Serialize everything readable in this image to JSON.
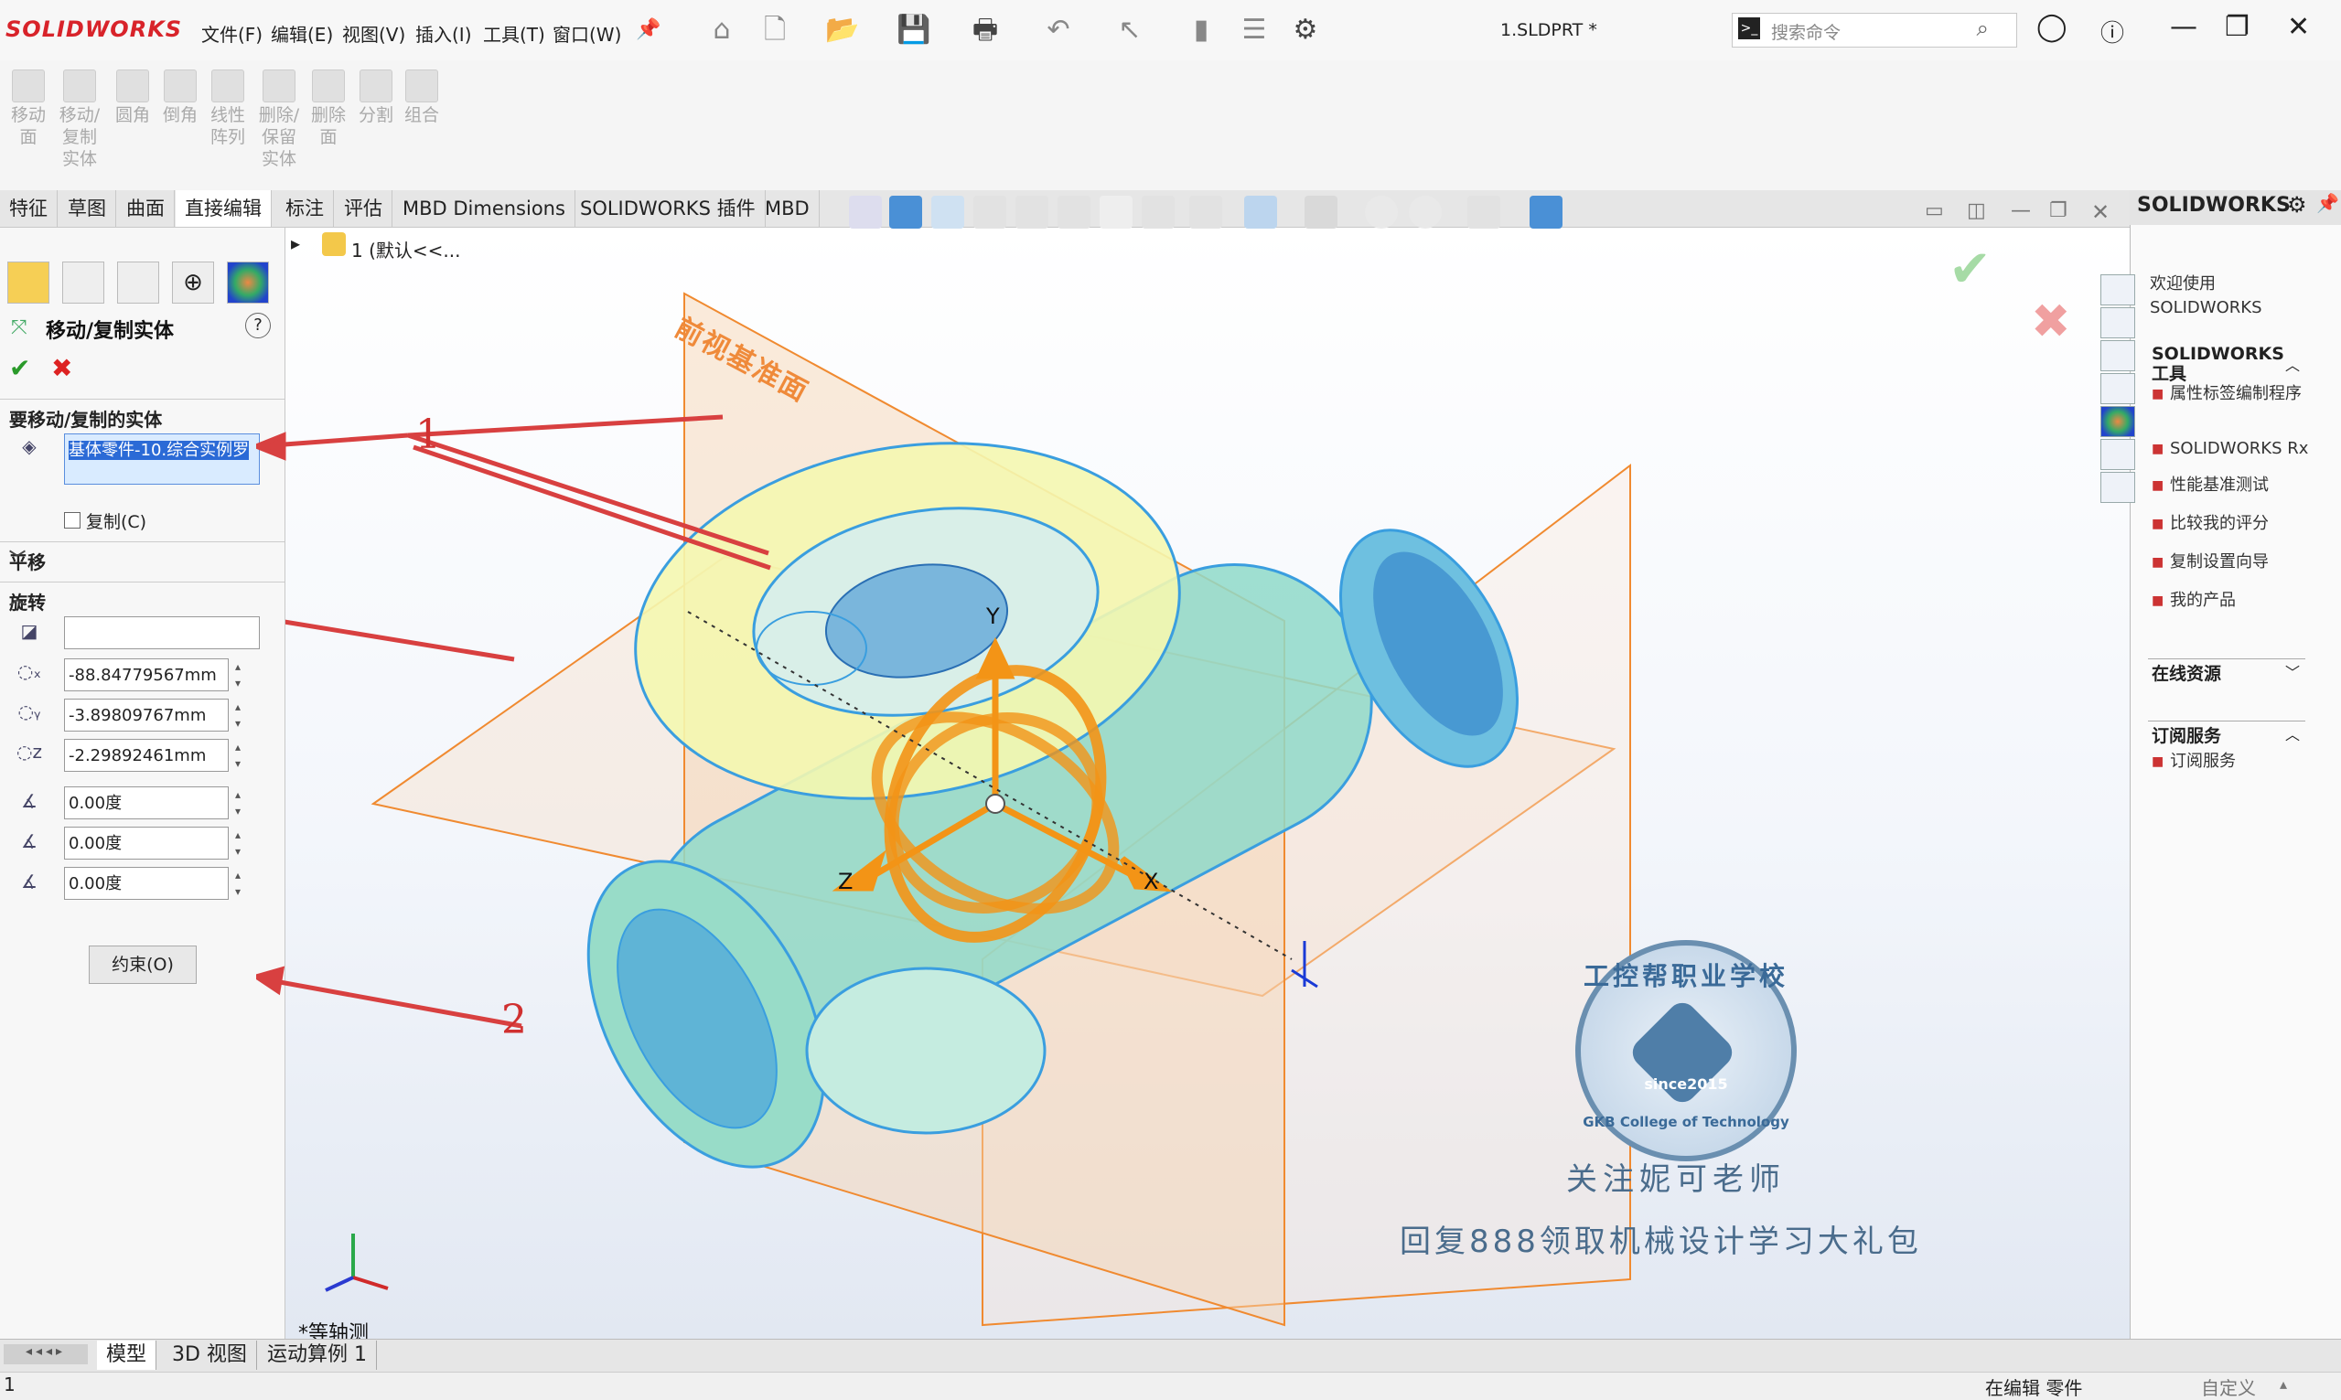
{
  "app": {
    "logo": "SOLIDWORKS",
    "filename": "1.SLDPRT *"
  },
  "menu": [
    "文件(F)",
    "编辑(E)",
    "视图(V)",
    "插入(I)",
    "工具(T)",
    "窗口(W)"
  ],
  "search": {
    "placeholder": "搜索命令"
  },
  "commands": [
    {
      "label": "移动\n面"
    },
    {
      "label": "移动/\n复制\n实体"
    },
    {
      "label": "圆角"
    },
    {
      "label": "倒角"
    },
    {
      "label": "线性\n阵列"
    },
    {
      "label": "删除/\n保留\n实体"
    },
    {
      "label": "删除\n面"
    },
    {
      "label": "分割"
    },
    {
      "label": "组合"
    }
  ],
  "tabs": [
    "特征",
    "草图",
    "曲面",
    "直接编辑",
    "标注",
    "评估",
    "MBD Dimensions",
    "SOLIDWORKS 插件",
    "MBD"
  ],
  "active_tab": "直接编辑",
  "tree": {
    "item": "1  (默认<<..."
  },
  "property_manager": {
    "title": "移动/复制实体",
    "help": "?",
    "section_bodies": "要移动/复制的实体",
    "selected_body": "基体零件-10.综合实例罗",
    "copy_label": "复制(C)",
    "section_translate": "平移",
    "section_rotate": "旋转",
    "rotation_reference": "",
    "values": [
      "-88.84779567mm",
      "-3.89809767mm",
      "-2.29892461mm",
      "0.00度",
      "0.00度",
      "0.00度"
    ],
    "constraint_button": "约束(O)"
  },
  "viewport": {
    "plane_label": "前视基准面",
    "view_name": "*等轴测",
    "triad_labels": {
      "x": "X",
      "y": "Y",
      "z": "Z"
    },
    "annotations": [
      "1",
      "2"
    ],
    "watermark_school": "工控帮职业学校",
    "watermark_since": "since2015",
    "watermark_college": "GKB College of Technology",
    "watermark_line1": "关注妮可老师",
    "watermark_line2": "回复888领取机械设计学习大礼包"
  },
  "taskpane": {
    "header": "SOLIDWORKS",
    "welcome": "欢迎使用 SOLIDWORKS",
    "tools_section": "SOLIDWORKS 工具",
    "tools": [
      "属性标签编制程序",
      "SOLIDWORKS Rx",
      "性能基准测试",
      "比较我的评分",
      "复制设置向导",
      "我的产品"
    ],
    "online_section": "在线资源",
    "subscribe_section": "订阅服务",
    "subscribe_item": "订阅服务"
  },
  "bottom_tabs": [
    "模型",
    "3D 视图",
    "运动算例 1"
  ],
  "status": {
    "left": "1",
    "editing": "在编辑 零件",
    "custom": "自定义"
  }
}
